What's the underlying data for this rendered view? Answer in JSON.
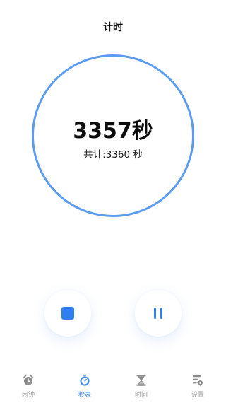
{
  "header": {
    "title": "计时"
  },
  "timer": {
    "value": "3357秒",
    "total": "共计:3360 秒"
  },
  "controls": {
    "stop_icon": "stop-icon",
    "pause_icon": "pause-icon"
  },
  "colors": {
    "accent": "#2f7ff0",
    "ring": "#5b9cf0",
    "inactive": "#9a9a9a"
  },
  "tabbar": {
    "active_index": 1,
    "items": [
      {
        "label": "闹钟",
        "icon": "alarm-clock-icon"
      },
      {
        "label": "秒表",
        "icon": "stopwatch-icon"
      },
      {
        "label": "时间",
        "icon": "hourglass-icon"
      },
      {
        "label": "设置",
        "icon": "settings-icon"
      }
    ]
  }
}
